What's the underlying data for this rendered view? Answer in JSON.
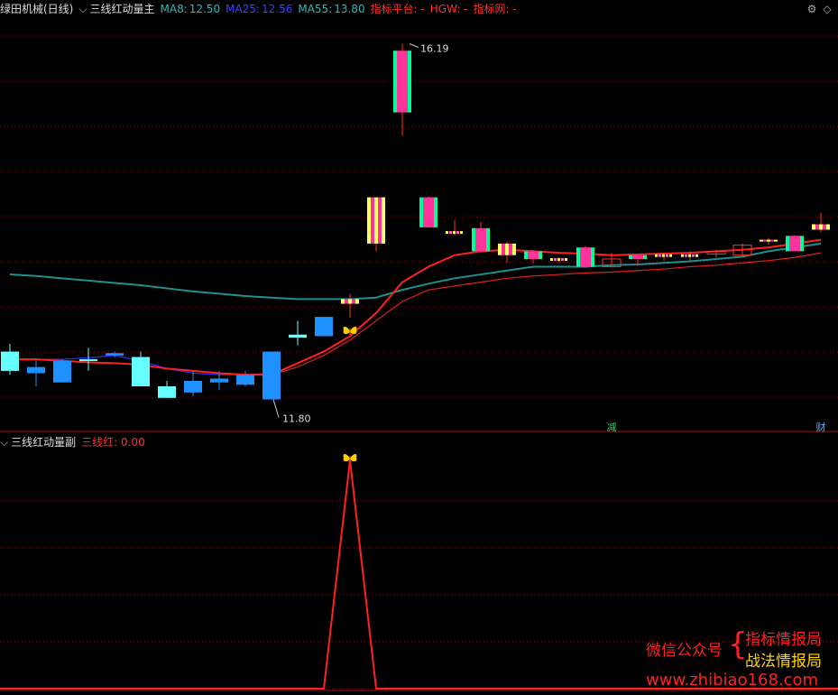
{
  "main_header": {
    "stock_name": "绿田机械(日线)",
    "indicator_name": "三线红动量主",
    "ma8_label": "MA8:",
    "ma8_value": "12.50",
    "ma25_label": "MA25:",
    "ma25_value": "12.56",
    "ma55_label": "MA55:",
    "ma55_value": "13.80",
    "platform": "指标平台: -",
    "hgw": "HGW: -",
    "site": "指标网: -"
  },
  "sub_header": {
    "indicator_name": "三线红动量副",
    "value_label": "三线红: 0.00"
  },
  "annotations": {
    "high_label": "16.19",
    "low_label": "11.80",
    "marker_reduce": "减",
    "marker_finance": "财"
  },
  "watermark": {
    "wechat": "微信公众号",
    "line1": "指标情报局",
    "line2": "战法情报局",
    "url": "www.zhibiao168.com"
  },
  "colors": {
    "background": "#000000",
    "grid": "#8b0000",
    "red_line": "#ff2020",
    "ma_teal": "#1f8f8f",
    "ma_blue": "#3030ff",
    "candle_cyan": "#66ffff",
    "candle_blue": "#1e90ff",
    "candle_pink": "#ff3399",
    "candle_yellow": "#ffff66"
  },
  "chart_data": {
    "type": "candlestick",
    "candles": [
      {
        "o": 12.2,
        "h": 12.3,
        "l": 11.9,
        "c": 11.95,
        "style": "cyan"
      },
      {
        "o": 12.0,
        "h": 12.1,
        "l": 11.75,
        "c": 11.92,
        "style": "blue"
      },
      {
        "o": 12.08,
        "h": 12.1,
        "l": 11.8,
        "c": 11.8,
        "style": "blue"
      },
      {
        "o": 12.1,
        "h": 12.25,
        "l": 11.95,
        "c": 12.1,
        "style": "cyan"
      },
      {
        "o": 12.15,
        "h": 12.2,
        "l": 12.12,
        "c": 12.18,
        "style": "blue"
      },
      {
        "o": 12.13,
        "h": 12.2,
        "l": 11.77,
        "c": 11.75,
        "style": "cyan"
      },
      {
        "o": 11.75,
        "h": 11.82,
        "l": 11.6,
        "c": 11.6,
        "style": "cyan"
      },
      {
        "o": 11.82,
        "h": 11.95,
        "l": 11.62,
        "c": 11.67,
        "style": "blue"
      },
      {
        "o": 11.85,
        "h": 11.95,
        "l": 11.7,
        "c": 11.8,
        "style": "blue"
      },
      {
        "o": 11.9,
        "h": 11.95,
        "l": 11.75,
        "c": 11.77,
        "style": "blue"
      },
      {
        "o": 12.2,
        "h": 12.2,
        "l": 11.58,
        "c": 11.58,
        "style": "blue"
      },
      {
        "o": 12.42,
        "h": 12.6,
        "l": 12.28,
        "c": 12.38,
        "style": "cyan"
      },
      {
        "o": 12.65,
        "h": 12.65,
        "l": 12.4,
        "c": 12.4,
        "style": "blue"
      },
      {
        "o": 12.88,
        "h": 12.95,
        "l": 12.64,
        "c": 12.82,
        "style": "yellow"
      },
      {
        "o": 14.2,
        "h": 14.2,
        "l": 13.5,
        "c": 13.6,
        "style": "yellow"
      },
      {
        "o": 16.1,
        "h": 16.19,
        "l": 15.0,
        "c": 15.3,
        "style": "pink"
      },
      {
        "o": 14.2,
        "h": 14.21,
        "l": 13.81,
        "c": 13.81,
        "style": "pink"
      },
      {
        "o": 13.75,
        "h": 13.9,
        "l": 13.7,
        "c": 13.75,
        "style": "dash"
      },
      {
        "o": 13.8,
        "h": 13.88,
        "l": 13.48,
        "c": 13.5,
        "style": "pink"
      },
      {
        "o": 13.6,
        "h": 13.62,
        "l": 13.35,
        "c": 13.45,
        "style": "yellow"
      },
      {
        "o": 13.5,
        "h": 13.52,
        "l": 13.34,
        "c": 13.4,
        "style": "pink"
      },
      {
        "o": 13.4,
        "h": 13.42,
        "l": 13.36,
        "c": 13.39,
        "style": "dash"
      },
      {
        "o": 13.55,
        "h": 13.57,
        "l": 13.29,
        "c": 13.3,
        "style": "pink"
      },
      {
        "o": 13.4,
        "h": 13.48,
        "l": 13.29,
        "c": 13.3,
        "style": "hollow"
      },
      {
        "o": 13.45,
        "h": 13.46,
        "l": 13.31,
        "c": 13.4,
        "style": "pink"
      },
      {
        "o": 13.45,
        "h": 13.47,
        "l": 13.38,
        "c": 13.45,
        "style": "dash"
      },
      {
        "o": 13.45,
        "h": 13.5,
        "l": 13.38,
        "c": 13.45,
        "style": "dash"
      },
      {
        "o": 13.48,
        "h": 13.52,
        "l": 13.42,
        "c": 13.5,
        "style": "hollow"
      },
      {
        "o": 13.45,
        "h": 13.6,
        "l": 13.45,
        "c": 13.58,
        "style": "hollow"
      },
      {
        "o": 13.65,
        "h": 13.67,
        "l": 13.59,
        "c": 13.65,
        "style": "yellow"
      },
      {
        "o": 13.7,
        "h": 13.71,
        "l": 13.5,
        "c": 13.5,
        "style": "pink"
      },
      {
        "o": 13.85,
        "h": 14.0,
        "l": 13.75,
        "c": 13.78,
        "style": "yellow"
      }
    ],
    "ma_teal": [
      13.2,
      13.18,
      13.15,
      13.12,
      13.09,
      13.06,
      13.02,
      12.98,
      12.95,
      12.92,
      12.9,
      12.88,
      12.88,
      12.88,
      12.9,
      13.0,
      13.08,
      13.15,
      13.2,
      13.25,
      13.3,
      13.3,
      13.3,
      13.32,
      13.33,
      13.35,
      13.37,
      13.4,
      13.43,
      13.5,
      13.55,
      13.6
    ],
    "ma_red_fast": [
      12.1,
      12.1,
      12.08,
      12.06,
      12.05,
      12.03,
      11.98,
      11.95,
      11.92,
      11.9,
      11.9,
      12.05,
      12.2,
      12.4,
      12.7,
      13.1,
      13.3,
      13.45,
      13.5,
      13.52,
      13.5,
      13.48,
      13.47,
      13.45,
      13.46,
      13.47,
      13.48,
      13.5,
      13.52,
      13.55,
      13.6,
      13.65
    ],
    "ma_red_slow": [
      null,
      null,
      null,
      null,
      null,
      null,
      null,
      null,
      null,
      null,
      11.9,
      12.0,
      12.15,
      12.35,
      12.6,
      12.85,
      13.0,
      13.05,
      13.1,
      13.15,
      13.18,
      13.2,
      13.22,
      13.23,
      13.25,
      13.27,
      13.3,
      13.32,
      13.35,
      13.38,
      13.42,
      13.48
    ],
    "ma_blue": [
      12.1,
      12.1,
      12.1,
      12.12,
      12.15,
      12.08,
      11.98,
      11.92,
      11.9,
      11.9,
      11.92
    ],
    "signal_index": 13,
    "sub_values": [
      0,
      0,
      0,
      0,
      0,
      0,
      0,
      0,
      0,
      0,
      0,
      0,
      0,
      1,
      0,
      0,
      0,
      0,
      0,
      0,
      0,
      0,
      0,
      0,
      0,
      0,
      0,
      0,
      0,
      0,
      0,
      0
    ],
    "sub_ylim": [
      0,
      1
    ],
    "ylim": [
      11.2,
      16.5
    ]
  }
}
